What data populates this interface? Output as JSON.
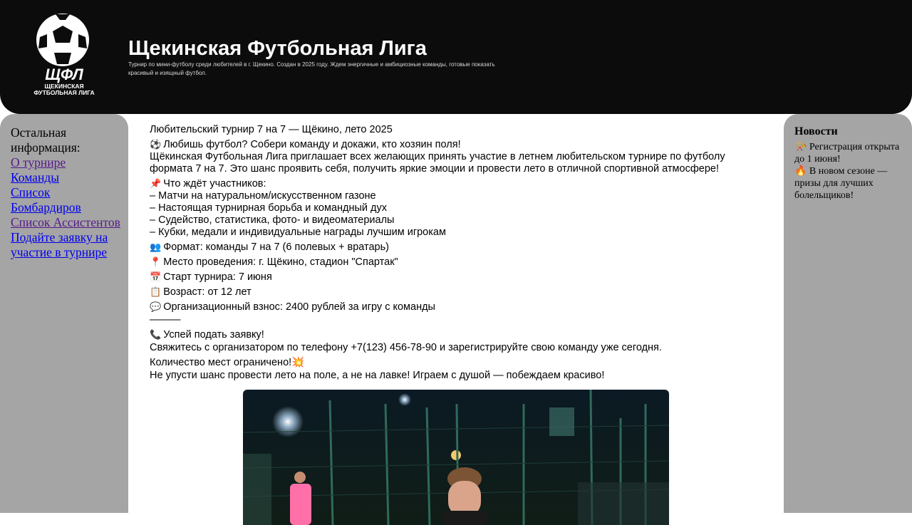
{
  "header": {
    "logo_abbr": "ЩФЛ",
    "logo_line1": "ЩЕКИНСКАЯ",
    "logo_line2": "ФУТБОЛЬНАЯ ЛИГА",
    "title": "Щекинская Футбольная Лига",
    "description": "Турнир по мини-футболу среди любителей в г. Щекино. Создан в 2025 году. Ждем энергичные и амбициозные команды, готовые показать красивый и изящный футбол."
  },
  "sidebar": {
    "heading": "Остальная информация:",
    "links": [
      {
        "label": "О турнире",
        "visited": true
      },
      {
        "label": "Команды",
        "visited": false
      },
      {
        "label": "Список Бомбардиров",
        "visited": false
      },
      {
        "label": "Список Ассистентов",
        "visited": true
      },
      {
        "label": "Подайте заявку на участие в турнире",
        "visited": false
      }
    ]
  },
  "news": {
    "heading": "Новости",
    "items": [
      {
        "icon": "megaphone-icon",
        "text": "📯 Регистрация открыта до 1 июня!"
      },
      {
        "icon": "fire-icon",
        "text": "🔥 В новом сезоне — призы для лучших болельщиков!"
      }
    ]
  },
  "main": {
    "title": "Любительский турнир 7 на 7 — Щёкино, лето 2025",
    "intro_emoji": "⚽",
    "intro": "Любишь футбол? Собери команду и докажи, кто хозяин поля!",
    "invite": "Щёкинская Футбольная Лига приглашает всех желающих принять участие в летнем любительском турнире по футболу формата 7 на 7. Это шанс проявить себя, получить яркие эмоции и провести лето в отличной спортивной атмосфере!",
    "expect_emoji": "📌",
    "expect_heading": "Что ждёт участников:",
    "expect_items": [
      "– Матчи на натуральном/искусственном газоне",
      "– Настоящая турнирная борьба и командный дух",
      "– Судейство, статистика, фото- и видеоматериалы",
      "– Кубки, медали и индивидуальные награды лучшим игрокам"
    ],
    "format_emoji": "👥",
    "format": "Формат: команды 7 на 7 (6 полевых + вратарь)",
    "place_emoji": "📍",
    "place": "Место проведения: г. Щёкино, стадион \"Спартак\"",
    "start_emoji": "📅",
    "start": "Старт турнира: 7 июня",
    "age_emoji": "📋",
    "age": "Возраст: от 12 лет",
    "fee_emoji": "💬",
    "fee": "Организационный взнос: 2400 рублей за игру с команды",
    "divider": "———",
    "cta_emoji": "📞",
    "cta": "Успей подать заявку!",
    "contact": "Свяжитесь с организатором по телефону +7(123) 456-78-90 и зарегистрируйте свою команду уже сегодня.",
    "limited": "Количество мест ограничено!💥",
    "slogan": "Не упусти шанс провести лето на поле, а не на лавке! Играем с душой — побеждаем красиво!"
  },
  "colors": {
    "header_bg": "#0c0c0c",
    "side_bg": "#a5a5a5",
    "link": "#0000ee",
    "link_visited": "#551a8b"
  }
}
